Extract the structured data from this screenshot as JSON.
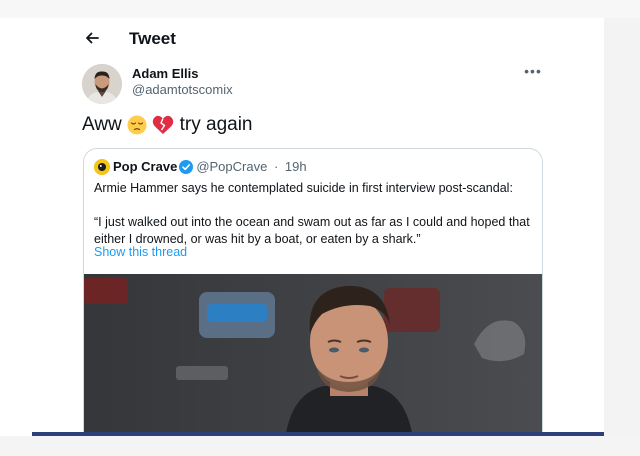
{
  "header": {
    "title": "Tweet"
  },
  "tweet": {
    "author_name": "Adam Ellis",
    "author_handle": "@adamtotscomix",
    "text_word1": "Aww",
    "emojis": [
      "pensive-face-icon",
      "broken-heart-icon"
    ],
    "text_word2": "try again"
  },
  "quote": {
    "name": "Pop Crave",
    "handle": "@PopCrave",
    "separator": "·",
    "time": "19h",
    "text_line1": "Armie Hammer says he contemplated suicide in first interview post-scandal:",
    "text_line2": "“I just walked out into the ocean and swam out as far as I could and hoped that either I drowned, or was hit by a boat, or eaten by a shark.”",
    "link_label": "Show this thread"
  },
  "colors": {
    "link": "#1d9bf0",
    "secondary_text": "#536471",
    "border": "#cfd9de",
    "bottom_rule": "#2c3f78"
  }
}
